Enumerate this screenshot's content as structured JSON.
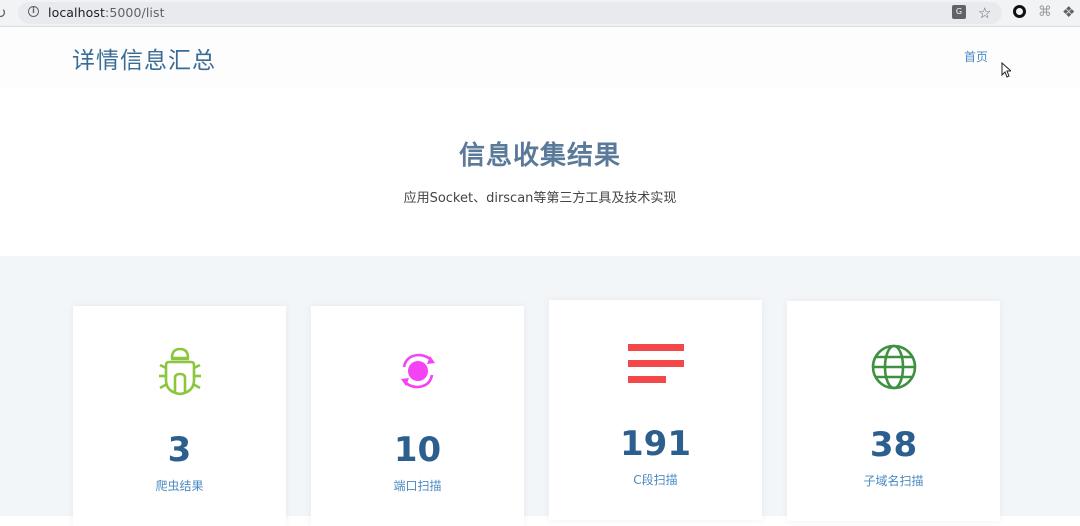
{
  "browser": {
    "url_host": "localhost",
    "url_rest": ":5000/list"
  },
  "header": {
    "title": "详情信息汇总",
    "nav_home": "首页"
  },
  "hero": {
    "title": "信息收集结果",
    "subtitle": "应用Socket、dirscan等第三方工具及技术实现"
  },
  "stats": [
    {
      "count": "3",
      "label": "爬虫结果",
      "icon": "bug-icon",
      "color": "#8cc63f"
    },
    {
      "count": "10",
      "label": "端口扫描",
      "icon": "sync-icon",
      "color": "#f442f4"
    },
    {
      "count": "191",
      "label": "C段扫描",
      "icon": "bars-icon",
      "color": "#f24848"
    },
    {
      "count": "38",
      "label": "子域名扫描",
      "icon": "globe-icon",
      "color": "#3f9142"
    }
  ]
}
